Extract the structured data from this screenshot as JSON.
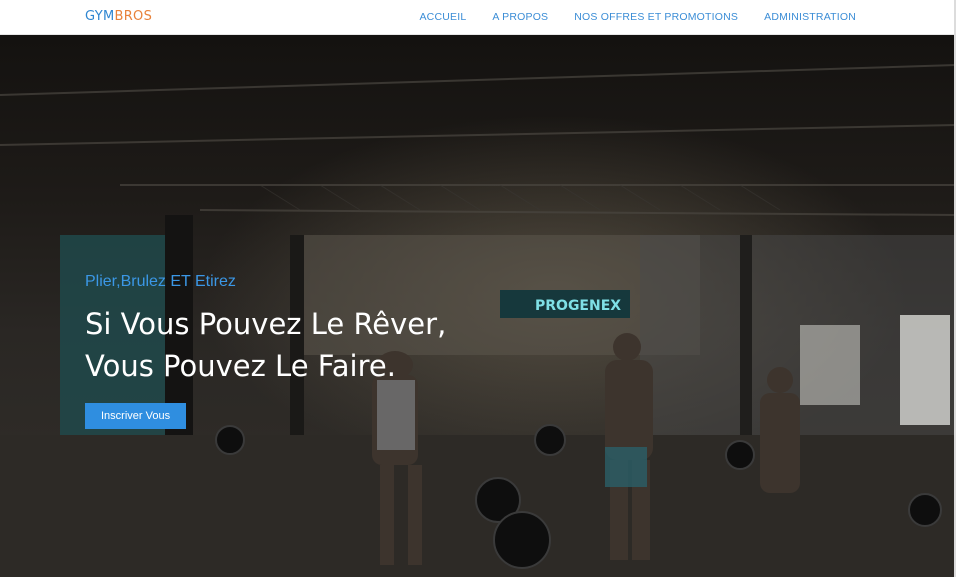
{
  "brand": {
    "part1": "GYM",
    "part2": "BROS"
  },
  "nav": {
    "items": [
      {
        "label": "ACCUEIL"
      },
      {
        "label": "A PROPOS"
      },
      {
        "label": "NOS OFFRES ET PROMOTIONS"
      },
      {
        "label": "ADMINISTRATION"
      }
    ]
  },
  "hero": {
    "subtitle": "Plier,Brulez ET Etirez",
    "headline_line1": "Si Vous Pouvez Le Rêver,",
    "headline_line2": "Vous Pouvez Le Faire.",
    "cta_label": "Inscriver Vous",
    "background_sign": "PROGENEX"
  },
  "colors": {
    "brand_blue": "#2f86d1",
    "brand_orange": "#e8823a",
    "accent": "#2f8ee0"
  }
}
